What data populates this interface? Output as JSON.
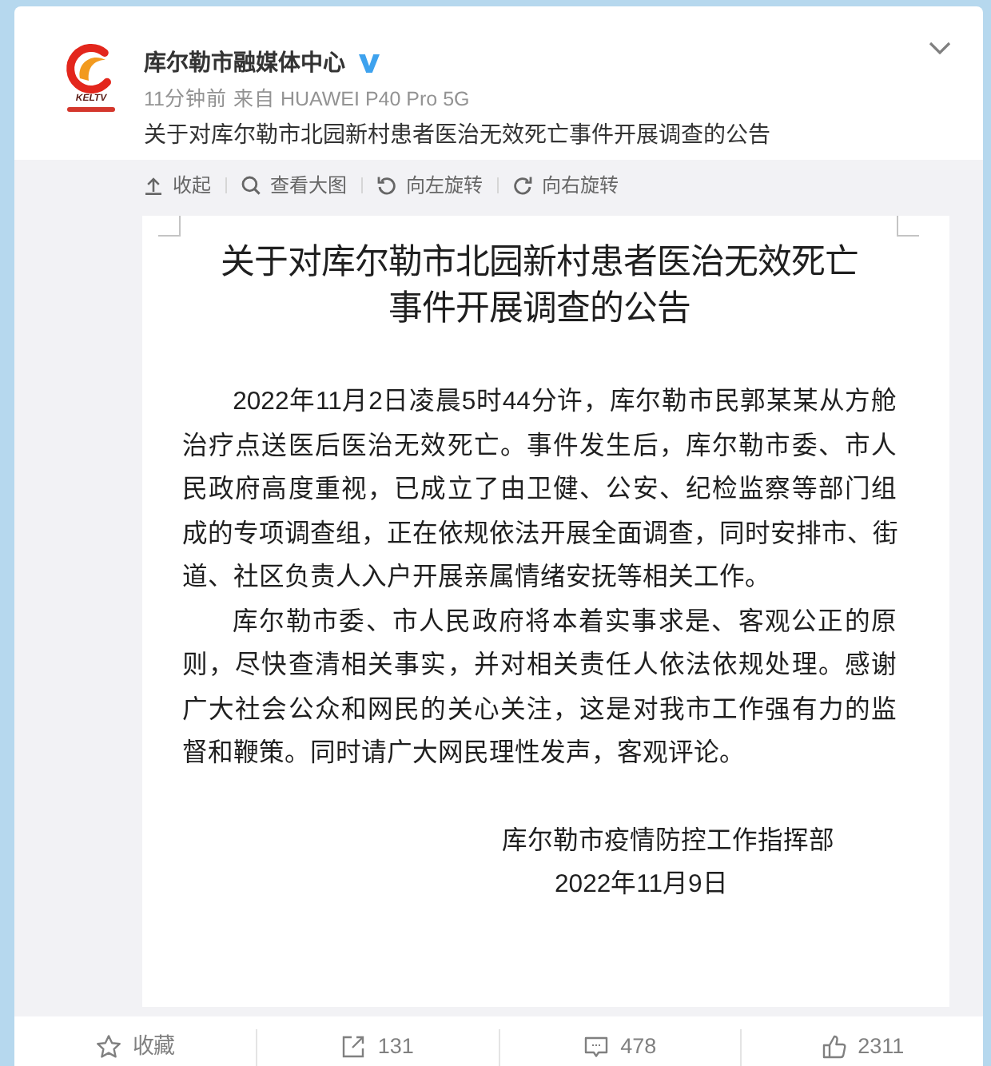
{
  "post": {
    "author": {
      "name": "库尔勒市融媒体中心",
      "verified": true,
      "logo_caption": "KELTV"
    },
    "time": "11分钟前",
    "source": "来自 HUAWEI P40 Pro 5G",
    "text": "关于对库尔勒市北园新村患者医治无效死亡事件开展调查的公告"
  },
  "media_toolbar": [
    {
      "kind": "collapse",
      "label": "收起"
    },
    {
      "kind": "zoom",
      "label": "查看大图"
    },
    {
      "kind": "rotate_left",
      "label": "向左旋转"
    },
    {
      "kind": "rotate_right",
      "label": "向右旋转"
    }
  ],
  "document": {
    "title": "关于对库尔勒市北园新村患者医治无效死亡事件开展调查的公告",
    "paragraphs": [
      {
        "lines": [
          "2022年11月2日凌晨5时44分许，库尔勒市民郭某某从方舱",
          "治疗点送医后医治无效死亡。事件发生后，库尔勒市委、市人",
          "民政府高度重视，已成立了由卫健、公安、纪检监察等部门组",
          "成的专项调查组，正在依规依法开展全面调查，同时安排市、街",
          "道、社区负责人入户开展亲属情绪安抚等相关工作。"
        ]
      },
      {
        "lines": [
          "库尔勒市委、市人民政府将本着实事求是、客观公正的原",
          "则，尽快查清相关事实，并对相关责任人依法依规处理。感谢",
          "广大社会公众和网民的关心关注，这是对我市工作强有力的监",
          "督和鞭策。同时请广大网民理性发声，客观评论。"
        ]
      }
    ],
    "signature": "库尔勒市疫情防控工作指挥部",
    "date": "2022年11月9日"
  },
  "actions": [
    {
      "kind": "favorite",
      "label": "收藏"
    },
    {
      "kind": "repost",
      "label": "131"
    },
    {
      "kind": "comment",
      "label": "478"
    },
    {
      "kind": "like",
      "label": "2311"
    }
  ]
}
